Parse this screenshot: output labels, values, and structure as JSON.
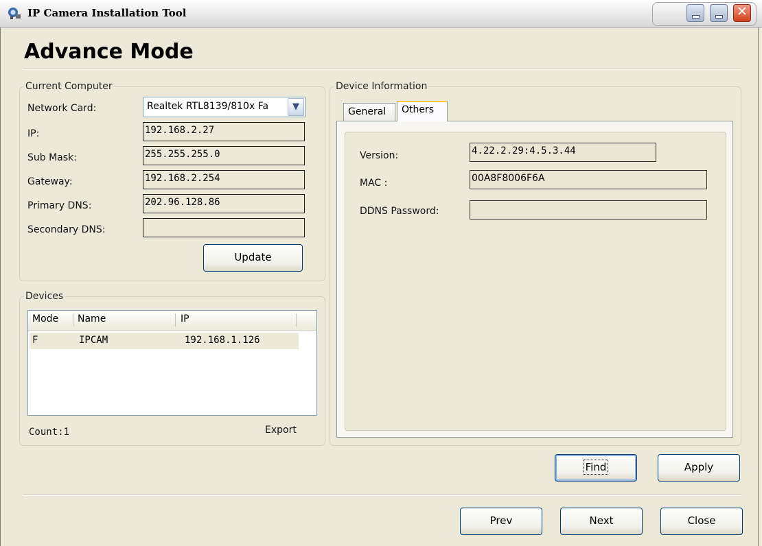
{
  "window": {
    "title": "IP Camera Installation Tool",
    "minimize_icon": "minimize-icon",
    "close_icon": "close-icon"
  },
  "page": {
    "heading": "Advance Mode"
  },
  "current_computer": {
    "legend": "Current Computer",
    "network_card_label": "Network Card:",
    "network_card_value": "Realtek RTL8139/810x Fa",
    "ip_label": "IP:",
    "ip_value": "192.168.2.27",
    "submask_label": "Sub Mask:",
    "submask_value": "255.255.255.0",
    "gateway_label": "Gateway:",
    "gateway_value": "192.168.2.254",
    "primary_dns_label": "Primary DNS:",
    "primary_dns_value": "202.96.128.86",
    "secondary_dns_label": "Secondary DNS:",
    "secondary_dns_value": "",
    "update_label": "Update"
  },
  "devices": {
    "legend": "Devices",
    "columns": [
      "Mode",
      "Name",
      "IP"
    ],
    "rows": [
      {
        "mode": "F",
        "name": "IPCAM",
        "ip": "192.168.1.126"
      }
    ],
    "count_label": "Count:",
    "count_value": "1",
    "export_label": "Export"
  },
  "device_info": {
    "legend": "Device Information",
    "tabs": [
      "General",
      "Others"
    ],
    "active_tab": "Others",
    "version_label": "Version:",
    "version_value": "4.22.2.29:4.5.3.44",
    "mac_label": "MAC  :",
    "mac_value": "00A8F8006F6A",
    "ddns_label": "DDNS Password:",
    "ddns_value": ""
  },
  "actions": {
    "find_label": "Find",
    "apply_label": "Apply",
    "prev_label": "Prev",
    "next_label": "Next",
    "close_label": "Close"
  },
  "colors": {
    "window_bg": "#ece9d8",
    "field_bg": "#ece9d8",
    "button_border": "#003c74",
    "active_tab_accent": "#ffc83c",
    "close_button": "#d4421e"
  }
}
